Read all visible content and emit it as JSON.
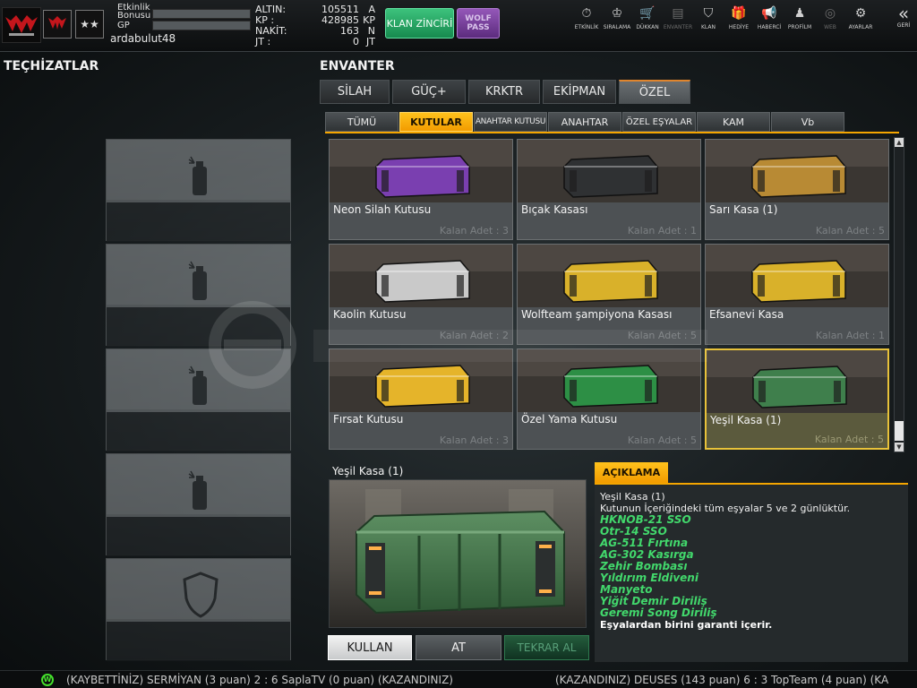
{
  "header": {
    "bar_labels": {
      "event_bonus_line1": "Etkinlik",
      "event_bonus_line2": "Bonusu",
      "gp": "GP"
    },
    "username": "ardabulut48",
    "currency": [
      {
        "label": "ALTIN:",
        "value": "105511",
        "unit": "A"
      },
      {
        "label": "KP   :",
        "value": "428985",
        "unit": "KP"
      },
      {
        "label": "NAKİT:",
        "value": "163",
        "unit": "N"
      },
      {
        "label": "JT   :",
        "value": "0",
        "unit": "JT"
      }
    ],
    "klan_button": "KLAN ZİNCİRİ",
    "wolf_button_line1": "WOLF",
    "wolf_button_line2": "PASS",
    "nav": [
      {
        "label": "ETKİNLİK",
        "icon": "stopwatch-icon",
        "glyph": "⏱"
      },
      {
        "label": "SIRALAMA",
        "icon": "medal-icon",
        "glyph": "♔"
      },
      {
        "label": "DÜKKAN",
        "icon": "cart-icon",
        "glyph": "🛒"
      },
      {
        "label": "ENVANTER",
        "icon": "inventory-icon",
        "glyph": "▤"
      },
      {
        "label": "KLAN",
        "icon": "shield-icon",
        "glyph": "⛉"
      },
      {
        "label": "HEDİYE",
        "icon": "gift-icon",
        "glyph": "🎁"
      },
      {
        "label": "HABERCİ",
        "icon": "megaphone-icon",
        "glyph": "📢"
      },
      {
        "label": "PROFİLM",
        "icon": "profile-icon",
        "glyph": "♟"
      },
      {
        "label": "WEB",
        "icon": "globe-icon",
        "glyph": "◎"
      },
      {
        "label": "AYARLAR",
        "icon": "gear-icon",
        "glyph": "⚙"
      }
    ],
    "back_label": "GERİ",
    "back_glyph": "«"
  },
  "left": {
    "title": "TEÇHİZATLAR"
  },
  "inventory": {
    "title": "ENVANTER",
    "main_tabs": [
      "SİLAH",
      "GÜÇ+",
      "KRKTR",
      "EKİPMAN",
      "ÖZEL"
    ],
    "sub_tabs": [
      "TÜMÜ",
      "KUTULAR",
      "ANAHTAR KUTUSU",
      "ANAHTAR",
      "ÖZEL EŞYALAR",
      "KAM",
      "Vb"
    ],
    "items": [
      {
        "name": "Neon Silah Kutusu",
        "count": "Kalan Adet : 3",
        "color": "#7a3fb0"
      },
      {
        "name": "Bıçak Kasası",
        "count": "Kalan Adet : 1",
        "color": "#2f3133"
      },
      {
        "name": "Sarı Kasa (1)",
        "count": "Kalan Adet : 5",
        "color": "#b88a34"
      },
      {
        "name": "Kaolin Kutusu",
        "count": "Kalan Adet : 2",
        "color": "#c9c9c9"
      },
      {
        "name": "Wolfteam şampiyona Kasası",
        "count": "Kalan Adet : 5",
        "color": "#d9b12a"
      },
      {
        "name": "Efsanevi Kasa",
        "count": "Kalan Adet : 1",
        "color": "#d9b12a"
      },
      {
        "name": "Fırsat Kutusu",
        "count": "Kalan Adet : 3",
        "color": "#e5b42a"
      },
      {
        "name": "Özel Yama Kutusu",
        "count": "Kalan Adet : 5",
        "color": "#2d8f45"
      },
      {
        "name": "Yeşil Kasa (1)",
        "count": "Kalan Adet : 5",
        "color": "#3f7f4c"
      }
    ]
  },
  "detail": {
    "name": "Yeşil Kasa (1)",
    "buttons": {
      "use": "KULLAN",
      "drop": "AT",
      "rebuy": "TEKRAR AL"
    }
  },
  "description": {
    "tab": "AÇIKLAMA",
    "title": "Yeşil Kasa (1)",
    "subtitle": "Kutunun İçeriğindeki tüm eşyalar 5 ve 2 günlüktür.",
    "items": [
      "HKNOB-21 SSO",
      "Otr-14 SSO",
      "AG-511 Fırtına",
      "AG-302 Kasırga",
      "Zehir Bombası",
      "Yıldırım Eldiveni",
      "Manyeto",
      "Yiğit Demir Diriliş",
      "Geremi Song Diriliş"
    ],
    "footer": "Eşyalardan birini garanti içerir."
  },
  "ticker": {
    "left": "(KAYBETTİNİZ) SERMİYAN (3 puan) 2 : 6 SaplaTV (0 puan) (KAZANDINIZ)",
    "right": "(KAZANDINIZ) DEUSES (143 puan) 6 : 3 TopTeam (4 puan) (KA"
  },
  "colors": {
    "accent": "#f4a500",
    "green_text": "#42d86c",
    "klan": "#2aa866",
    "wolf": "#7a3f9e"
  }
}
